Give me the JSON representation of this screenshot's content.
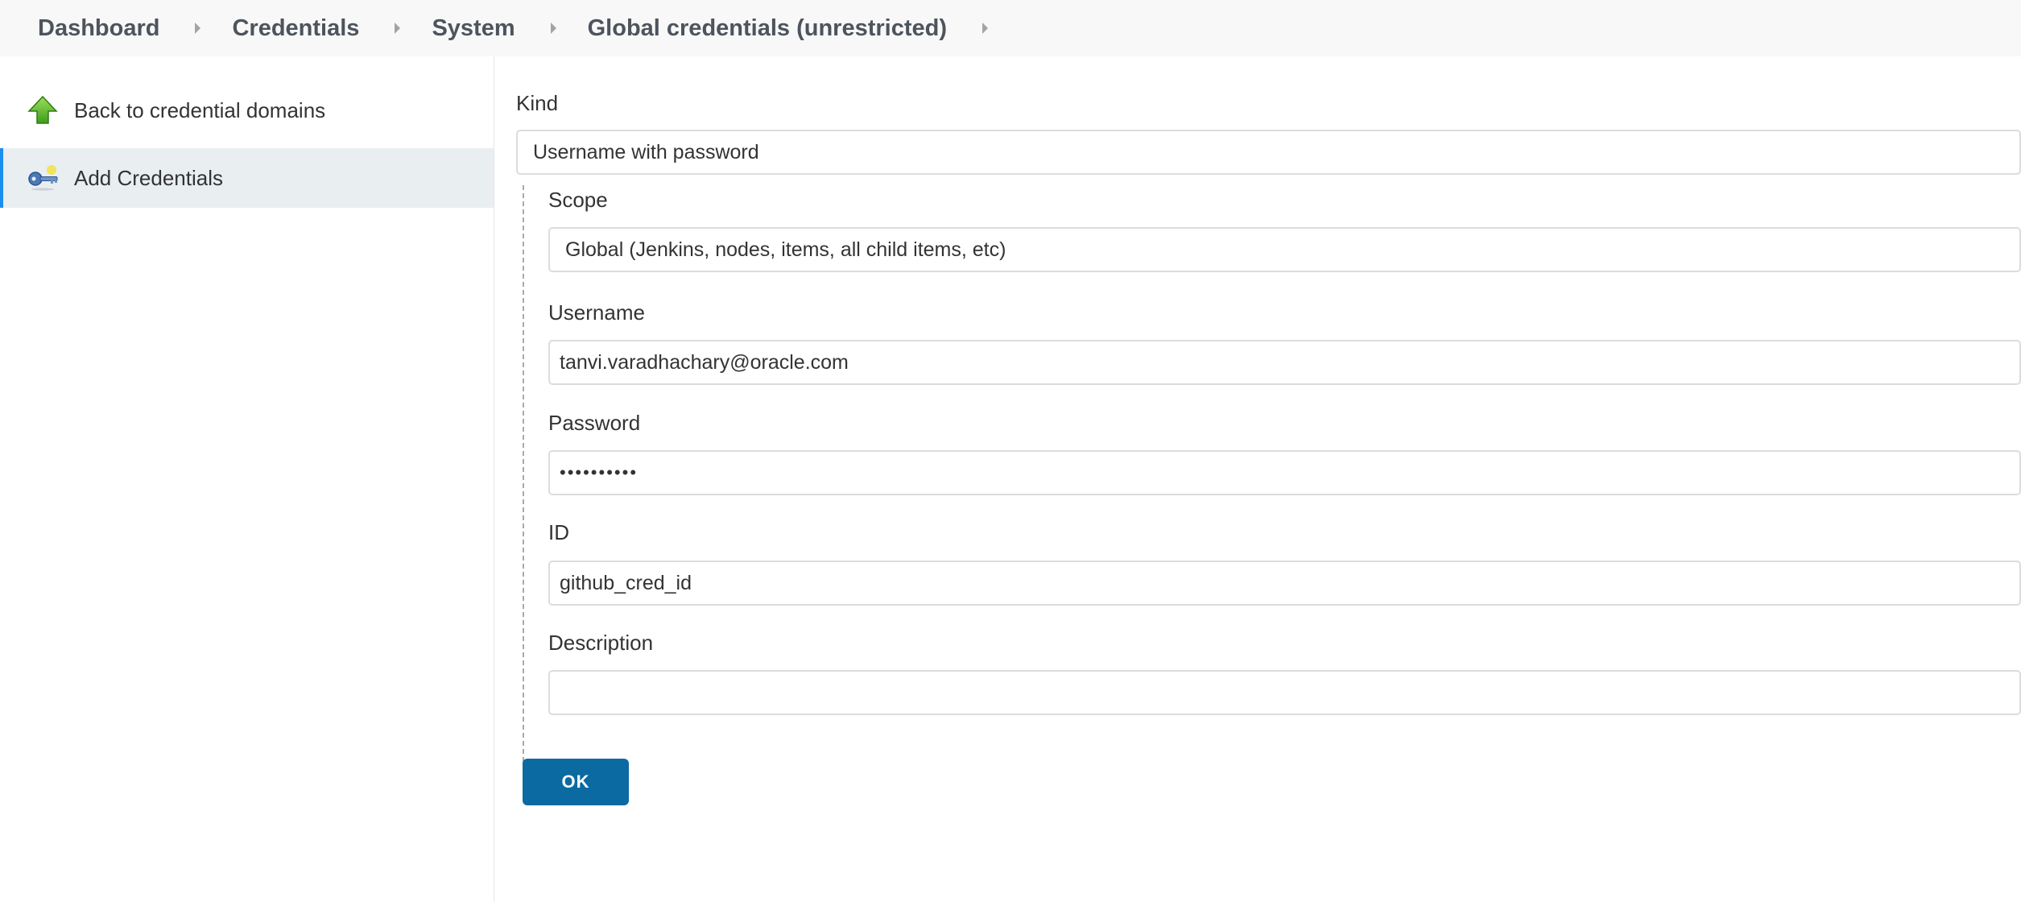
{
  "breadcrumb": {
    "items": [
      "Dashboard",
      "Credentials",
      "System",
      "Global credentials (unrestricted)"
    ]
  },
  "sidebar": {
    "items": [
      {
        "label": "Back to credential domains",
        "icon": "green-up-arrow-icon"
      },
      {
        "label": "Add Credentials",
        "icon": "key-icon"
      }
    ]
  },
  "form": {
    "kind_label": "Kind",
    "kind_value": "Username with password",
    "scope_label": "Scope",
    "scope_value": "Global (Jenkins, nodes, items, all child items, etc)",
    "username_label": "Username",
    "username_value": "tanvi.varadhachary@oracle.com",
    "password_label": "Password",
    "password_value": "••••••••••",
    "id_label": "ID",
    "id_value": "github_cred_id",
    "description_label": "Description",
    "description_value": "",
    "ok_label": "OK"
  },
  "colors": {
    "accent": "#0b6aa2",
    "active_border": "#1b8ef0",
    "active_bg": "#e9eef1"
  }
}
